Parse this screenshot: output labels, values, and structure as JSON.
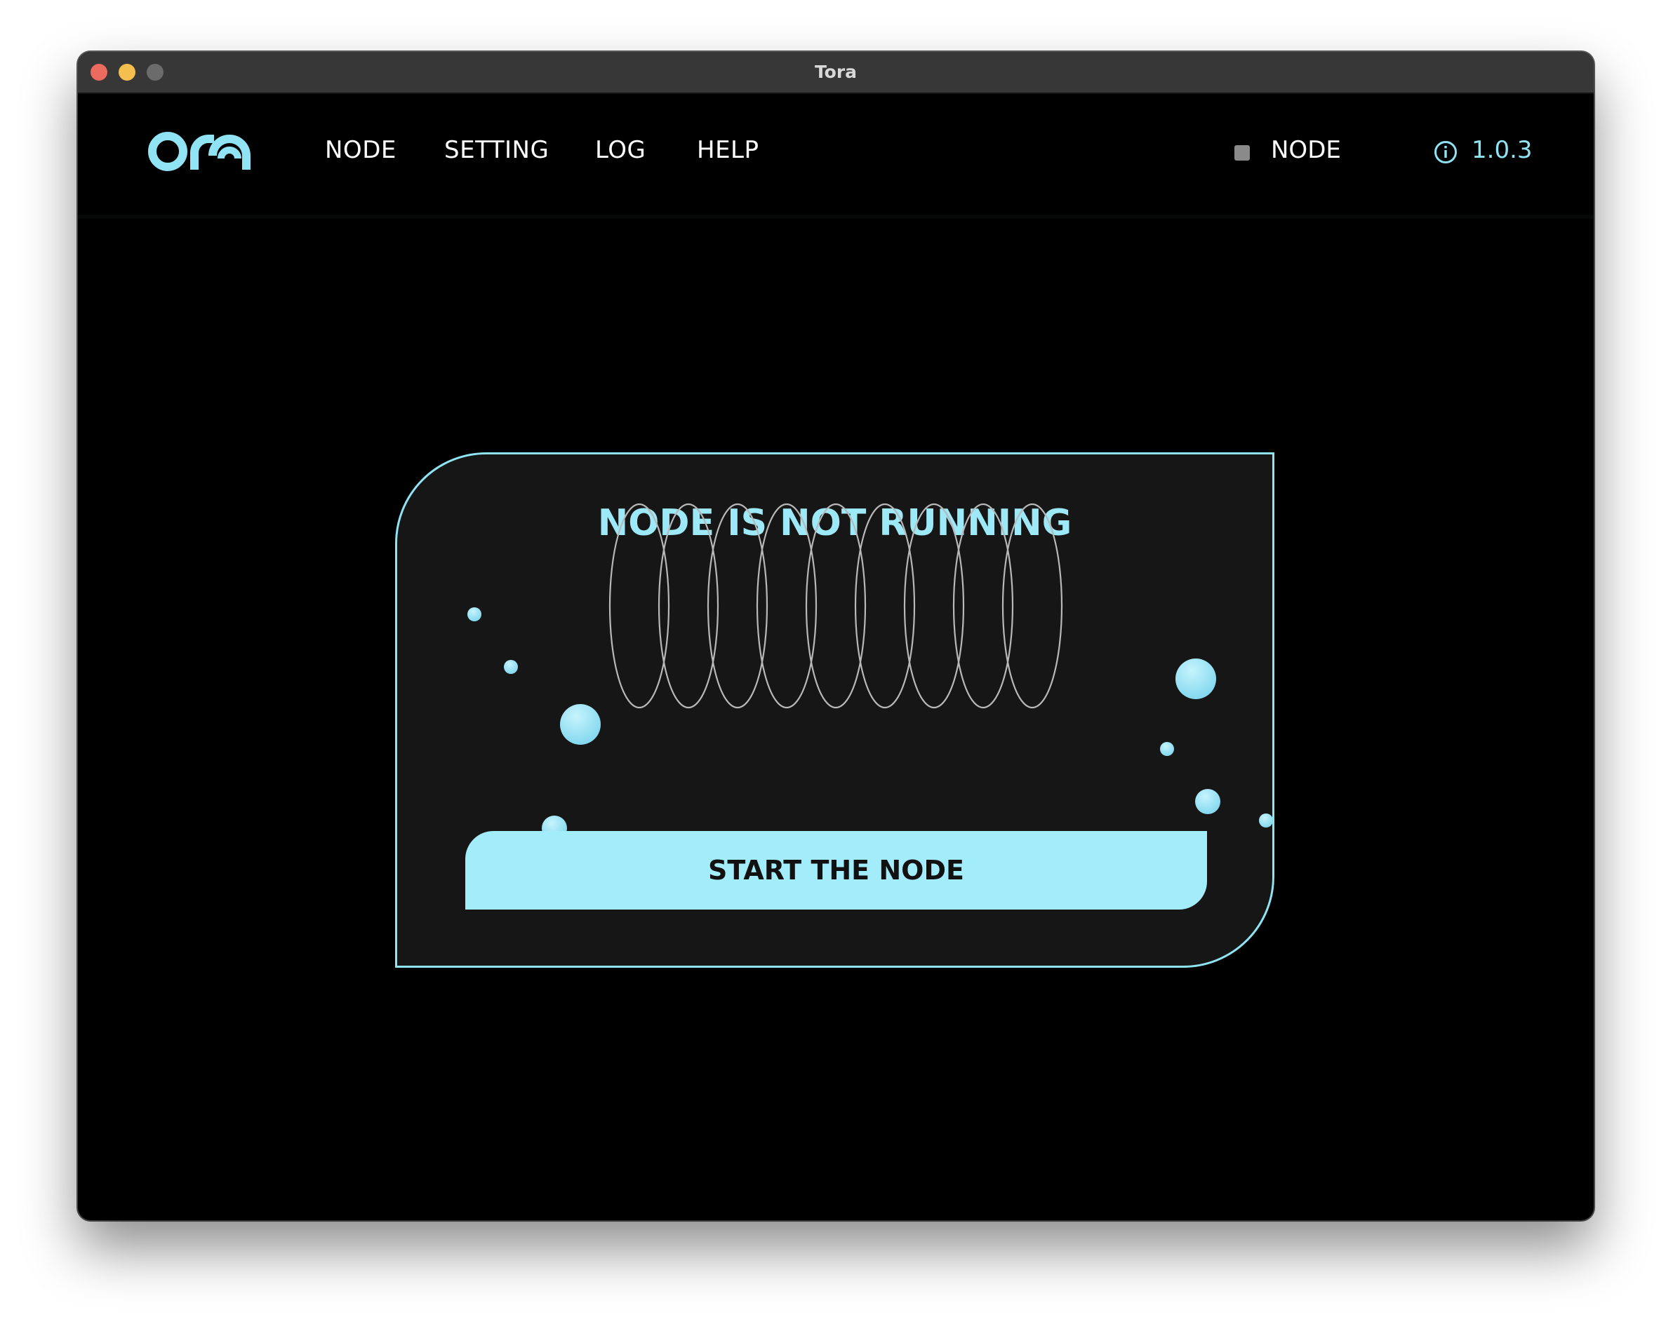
{
  "window": {
    "title": "Tora"
  },
  "navbar": {
    "logo_icon": "ora-logo",
    "items": [
      {
        "label": "NODE"
      },
      {
        "label": "SETTING"
      },
      {
        "label": "LOG"
      },
      {
        "label": "HELP"
      }
    ],
    "node_status_label": "NODE",
    "version": "1.0.3"
  },
  "main": {
    "status_title": "NODE IS NOT RUNNING",
    "start_button_label": "START THE NODE"
  },
  "colors": {
    "accent": "#8fe3f3",
    "button_bg": "#a3ecf9",
    "background": "#000000",
    "card_bg": "#161616",
    "status_indicator": "#8a8a8a"
  }
}
